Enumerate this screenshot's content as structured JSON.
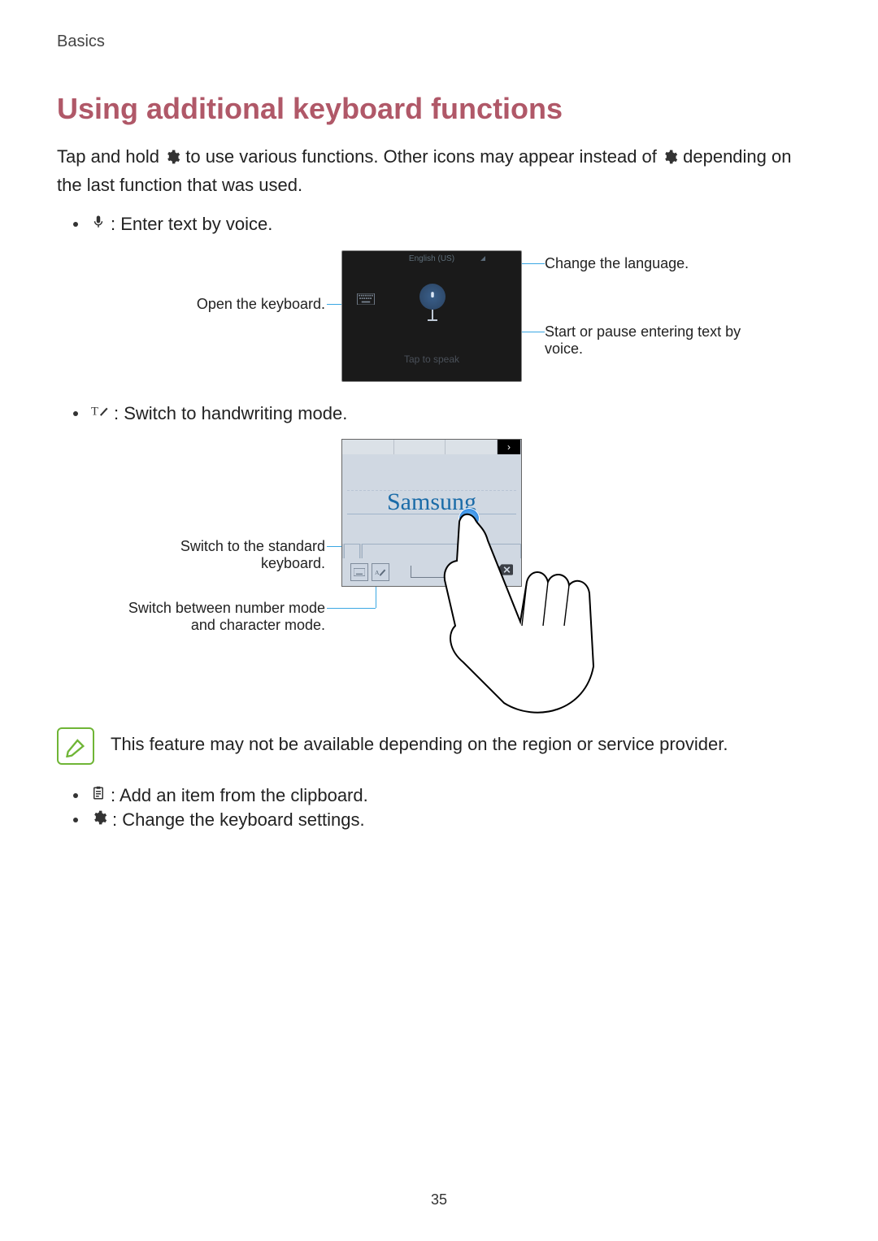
{
  "chapter": "Basics",
  "heading": "Using additional keyboard functions",
  "intro_1": "Tap and hold ",
  "intro_2": " to use various functions. Other icons may appear instead of ",
  "intro_3": " depending on the last function that was used.",
  "voice_item": " : Enter text by voice.",
  "voice_callouts": {
    "open_keyboard": "Open the keyboard.",
    "change_language": "Change the language.",
    "start_pause": "Start or pause entering text by voice."
  },
  "voice_panel": {
    "language": "English (US)",
    "hint": "Tap to speak"
  },
  "hw_item": " : Switch to handwriting mode.",
  "hw_callouts": {
    "standard": "Switch to the standard keyboard.",
    "number_char": "Switch between number mode and character mode."
  },
  "hw_panel": {
    "written_text": "Samsung"
  },
  "note": "This feature may not be available depending on the region or service provider.",
  "clipboard_item": " : Add an item from the clipboard.",
  "settings_item": " : Change the keyboard settings.",
  "page_number": "35"
}
